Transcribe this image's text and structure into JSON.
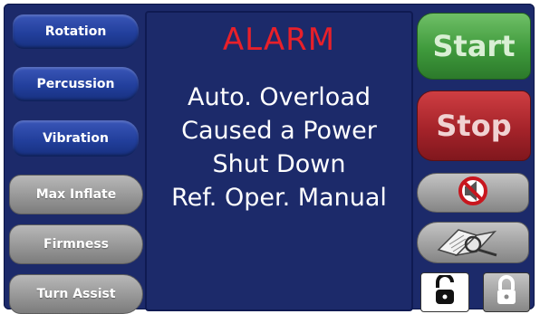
{
  "left_buttons": [
    {
      "label": "Rotation"
    },
    {
      "label": "Percussion"
    },
    {
      "label": "Vibration"
    },
    {
      "label": "Max Inflate"
    },
    {
      "label": "Firmness"
    },
    {
      "label": "Turn Assist"
    }
  ],
  "display": {
    "title": "ALARM",
    "lines": [
      "Auto. Overload",
      "Caused a Power",
      "Shut Down",
      "Ref. Oper. Manual"
    ]
  },
  "right_buttons": {
    "start_label": "Start",
    "stop_label": "Stop"
  },
  "icons": {
    "mute": "alarm-silence-icon",
    "manual": "manual-magnifier-icon",
    "unlock": "unlocked-padlock-icon",
    "lock": "locked-padlock-icon"
  },
  "colors": {
    "panel_bg": "#1c2a6a",
    "alarm_red": "#e8202a",
    "start_green": "#3f9a3c",
    "stop_red": "#a5232a"
  }
}
